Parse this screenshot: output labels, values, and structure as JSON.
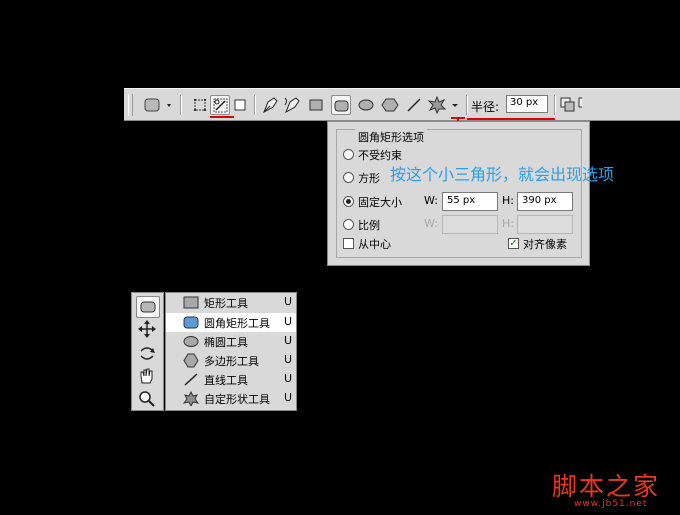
{
  "options_bar": {
    "radius_label": "半径:",
    "radius_value": "30 px",
    "icons": [
      "shape-layers-icon",
      "paths-icon",
      "fill-pixels-icon",
      "pen-icon",
      "freeform-pen-icon",
      "rectangle-icon",
      "rounded-rectangle-icon",
      "ellipse-icon",
      "polygon-icon",
      "line-icon",
      "custom-shape-icon",
      "dropdown-triangle-icon",
      "new-shape-area-icon"
    ]
  },
  "options_panel": {
    "title": "圆角矩形选项",
    "unconstrained": "不受约束",
    "square": "方形",
    "fixed_size": "固定大小",
    "proportional": "比例",
    "from_center": "从中心",
    "snap_pixels": "对齐像素",
    "w_label": "W:",
    "h_label": "H:",
    "w_value": "55 px",
    "h_value": "390 px",
    "w2_label": "W:",
    "h2_label": "H:"
  },
  "annotation": "按这个小三角形，就会出现选项",
  "tools_flyout": {
    "items": [
      {
        "name": "矩形工具",
        "key": "U"
      },
      {
        "name": "圆角矩形工具",
        "key": "U"
      },
      {
        "name": "椭圆工具",
        "key": "U"
      },
      {
        "name": "多边形工具",
        "key": "U"
      },
      {
        "name": "直线工具",
        "key": "U"
      },
      {
        "name": "自定形状工具",
        "key": "U"
      }
    ]
  },
  "watermark": {
    "logo": "脚本之家",
    "url": "www.jb51.net"
  },
  "colors": {
    "background": "#000000",
    "panel": "#d9d9d9",
    "annotation": "#2aa0ea",
    "marker_red": "#e00000",
    "watermark": "#e8391f"
  }
}
